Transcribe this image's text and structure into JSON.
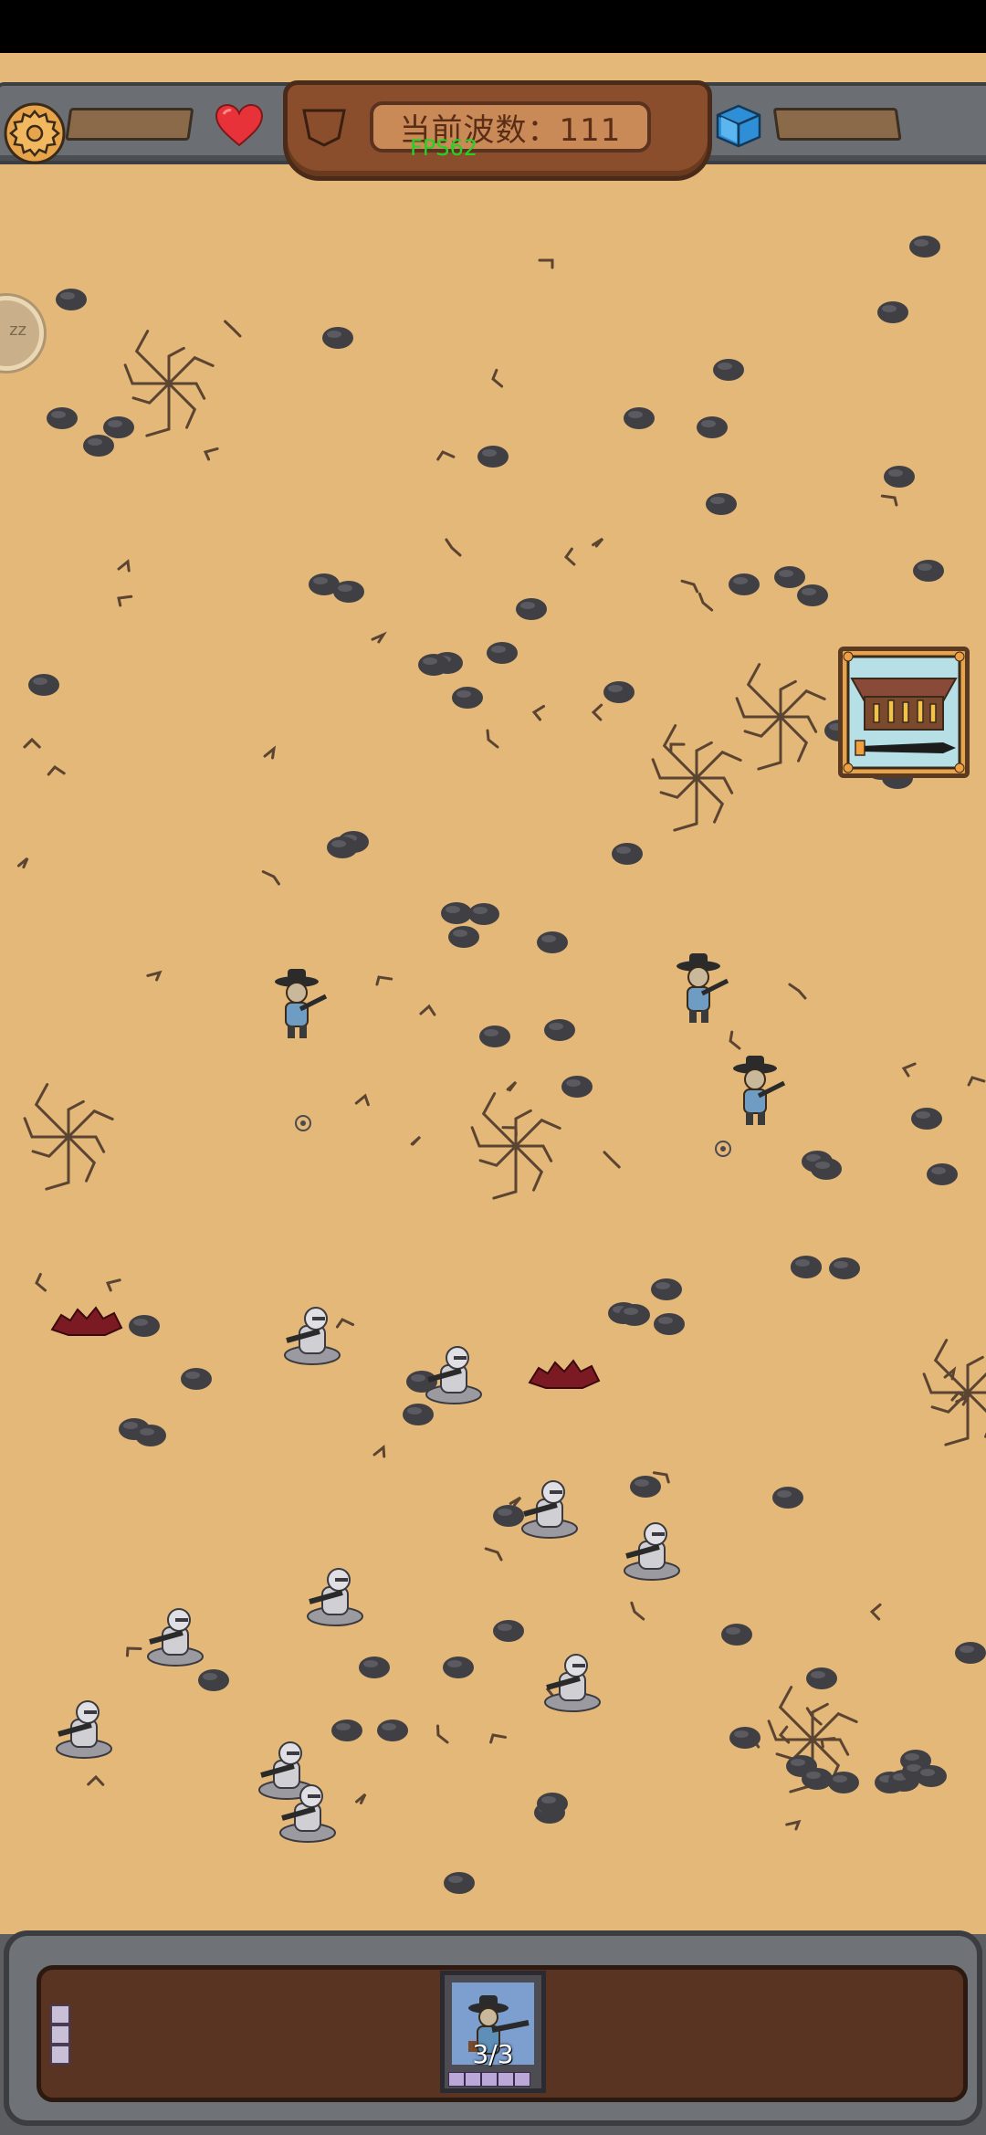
{
  "hud": {
    "wave_label": "当前波数：",
    "wave_number": "111",
    "fps_text": "FPS62",
    "icons": [
      "gear-icon",
      "heart-icon",
      "shield-icon",
      "cube-icon"
    ]
  },
  "side_button": {
    "text": "zz"
  },
  "treasure": {
    "icon": "treasure-chest-icon"
  },
  "units": {
    "selected_unit": {
      "count_text": "3/3",
      "icon": "cowboy-gunner-icon"
    }
  },
  "colors": {
    "sand": "#e3b878",
    "rock": "#3f3f44",
    "hud_gray": "#6b6f73",
    "wave_plate": "#8a4e2c",
    "fps_green": "#23d323",
    "heart_red": "#e8323a",
    "cube_blue": "#2f8fd6"
  }
}
